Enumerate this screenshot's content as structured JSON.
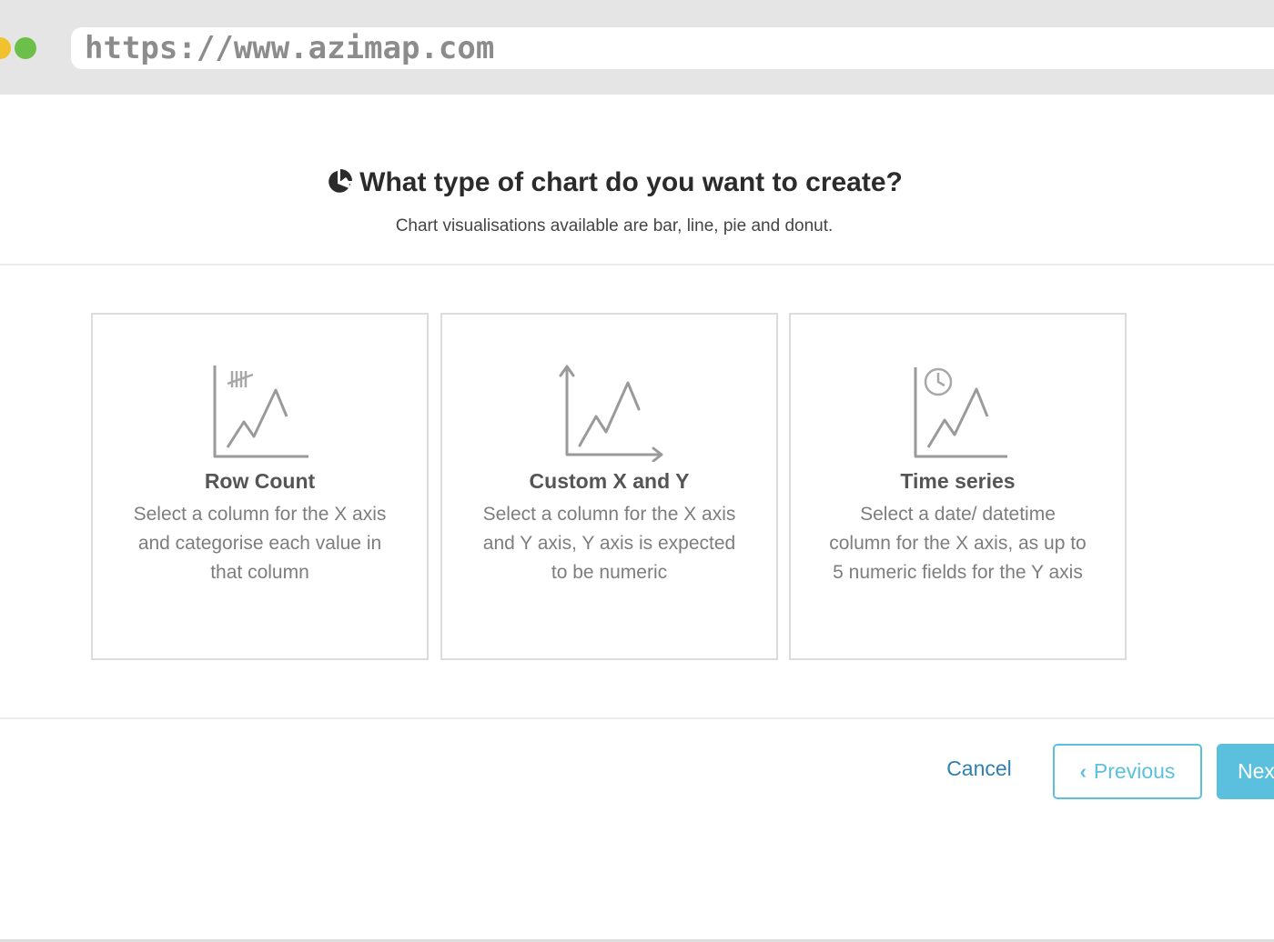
{
  "browser": {
    "url": "https://www.azimap.com"
  },
  "header": {
    "icon": "pie-chart-icon",
    "title": "What type of chart do you want to create?",
    "subtitle": "Chart visualisations available are bar, line, pie and donut."
  },
  "cards": [
    {
      "icon": "row-count-chart-icon",
      "title": "Row Count",
      "description": "Select a column for the X axis and categorise each value in that column"
    },
    {
      "icon": "custom-xy-chart-icon",
      "title": "Custom X and Y",
      "description": "Select a column for the X axis and Y axis, Y axis is expected to be numeric"
    },
    {
      "icon": "time-series-chart-icon",
      "title": "Time series",
      "description": "Select a date/ datetime column for the X axis, as up to 5 numeric fields for the Y axis"
    }
  ],
  "footer": {
    "cancel_label": "Cancel",
    "previous_label": "Previous",
    "next_label": "Next"
  },
  "colors": {
    "accent": "#5bc0de",
    "link": "#2f7fb0",
    "border": "#dcdcdc",
    "browser_chrome": "#e5e5e5"
  }
}
